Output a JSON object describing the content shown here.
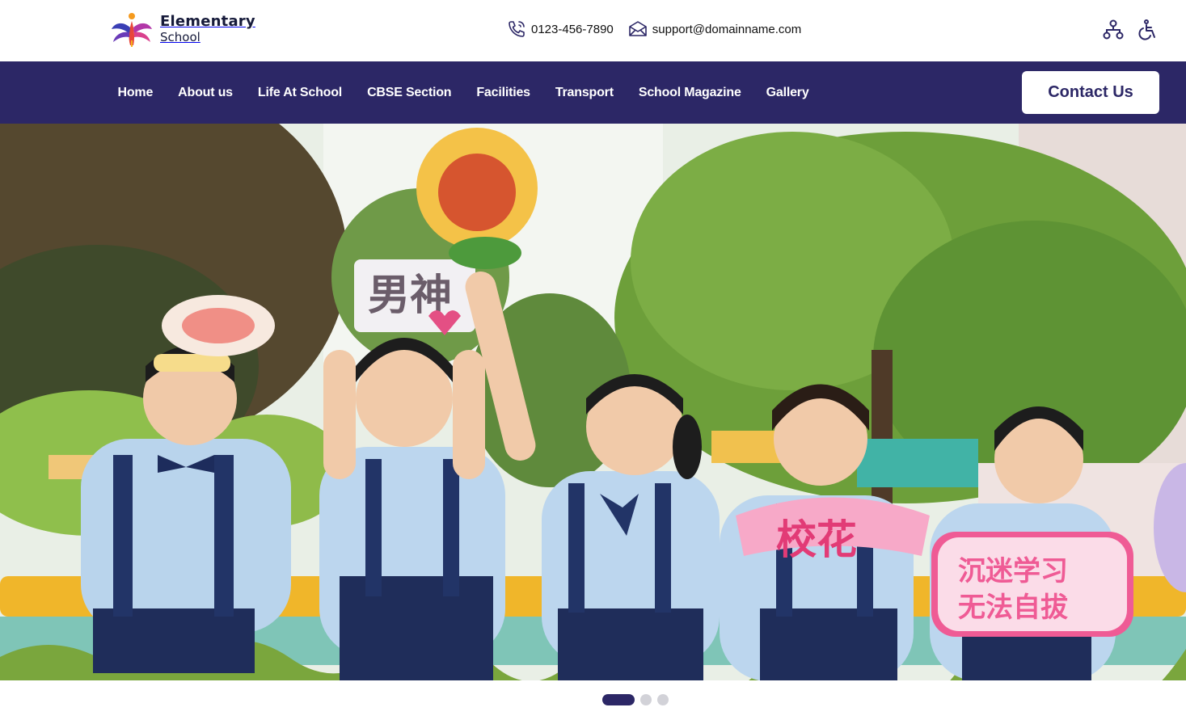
{
  "brand": {
    "name": "Elementary",
    "tagline": "School"
  },
  "contact": {
    "phone": "0123-456-7890",
    "email": "support@domainname.com"
  },
  "utilities": [
    {
      "icon": "sitemap-icon"
    },
    {
      "icon": "accessibility-icon"
    }
  ],
  "nav": {
    "items": [
      {
        "label": "Home"
      },
      {
        "label": "About us"
      },
      {
        "label": "Life At School"
      },
      {
        "label": "CBSE Section"
      },
      {
        "label": "Facilities"
      },
      {
        "label": "Transport"
      },
      {
        "label": "School Magazine"
      },
      {
        "label": "Gallery"
      }
    ],
    "cta_label": "Contact Us"
  },
  "hero": {
    "image": "photo of cheering schoolchildren in uniforms holding signs",
    "signs": [
      "男神",
      "校花",
      "沉迷学习",
      "无法自拔"
    ]
  },
  "carousel": {
    "slide_count": 3,
    "active_index": 0
  },
  "colors": {
    "primary": "#2c2766",
    "white": "#ffffff",
    "dot_inactive": "#d2d2d8"
  }
}
